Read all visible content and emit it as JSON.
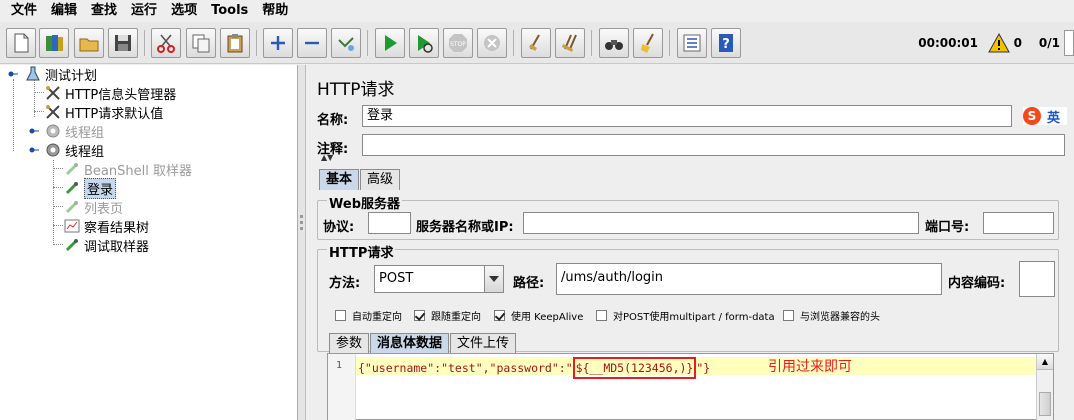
{
  "menu": [
    "文件",
    "编辑",
    "查找",
    "运行",
    "选项",
    "Tools",
    "帮助"
  ],
  "toolbar": {
    "timer": "00:00:01",
    "warnings": "0",
    "threads": "0/1",
    "buttons": [
      "new-file-icon",
      "templates-icon",
      "open-icon",
      "save-icon",
      "cut-icon",
      "copy-icon",
      "paste-icon",
      "expand-icon",
      "collapse-icon",
      "toggle-icon",
      "start-icon",
      "start-no-pause-icon",
      "stop-icon",
      "shutdown-icon",
      "clear-icon",
      "clear-all-icon",
      "search-icon",
      "reset-search-icon",
      "function-helper-icon",
      "help-icon"
    ]
  },
  "tree": {
    "root": "测试计划",
    "items": [
      {
        "label": "HTTP信息头管理器",
        "icon": "wrench-icon",
        "disabled": false
      },
      {
        "label": "HTTP请求默认值",
        "icon": "wrench-icon",
        "disabled": false
      },
      {
        "label": "线程组",
        "icon": "gear-icon",
        "disabled": true
      },
      {
        "label": "线程组",
        "icon": "gear-icon",
        "disabled": false
      },
      {
        "label": "BeanShell 取样器",
        "icon": "pipette-icon",
        "disabled": true
      },
      {
        "label": "登录",
        "icon": "pipette-icon",
        "disabled": false,
        "selected": true
      },
      {
        "label": "列表页",
        "icon": "pipette-icon",
        "disabled": true
      },
      {
        "label": "察看结果树",
        "icon": "chart-icon",
        "disabled": false
      },
      {
        "label": "调试取样器",
        "icon": "pipette-icon",
        "disabled": false
      }
    ]
  },
  "panel": {
    "title": "HTTP请求",
    "name_label": "名称:",
    "name_value": "登录",
    "comment_label": "注释:",
    "comment_value": "",
    "ime": {
      "logo": "S",
      "lang": "英"
    },
    "tabs": [
      "基本",
      "高级"
    ],
    "web_server": {
      "title": "Web服务器",
      "protocol_label": "协议:",
      "protocol_value": "",
      "server_label": "服务器名称或IP:",
      "server_value": "",
      "port_label": "端口号:",
      "port_value": ""
    },
    "http_request": {
      "title": "HTTP请求",
      "method_label": "方法:",
      "method_value": "POST",
      "path_label": "路径:",
      "path_value": "/ums/auth/login",
      "encoding_label": "内容编码:",
      "encoding_value": ""
    },
    "checkboxes": [
      {
        "label": "自动重定向",
        "checked": false
      },
      {
        "label": "跟随重定向",
        "checked": true
      },
      {
        "label": "使用 KeepAlive",
        "checked": true
      },
      {
        "label": "对POST使用multipart / form-data",
        "checked": false
      },
      {
        "label": "与浏览器兼容的头",
        "checked": false
      }
    ],
    "body_tabs": [
      "参数",
      "消息体数据",
      "文件上传"
    ],
    "editor": {
      "line_number": "1",
      "code_prefix": "{\"username\":\"test\",\"password\":\"",
      "code_highlight": "${__MD5(123456,)}",
      "code_suffix": "\"}",
      "annotation": "引用过来即可"
    }
  }
}
